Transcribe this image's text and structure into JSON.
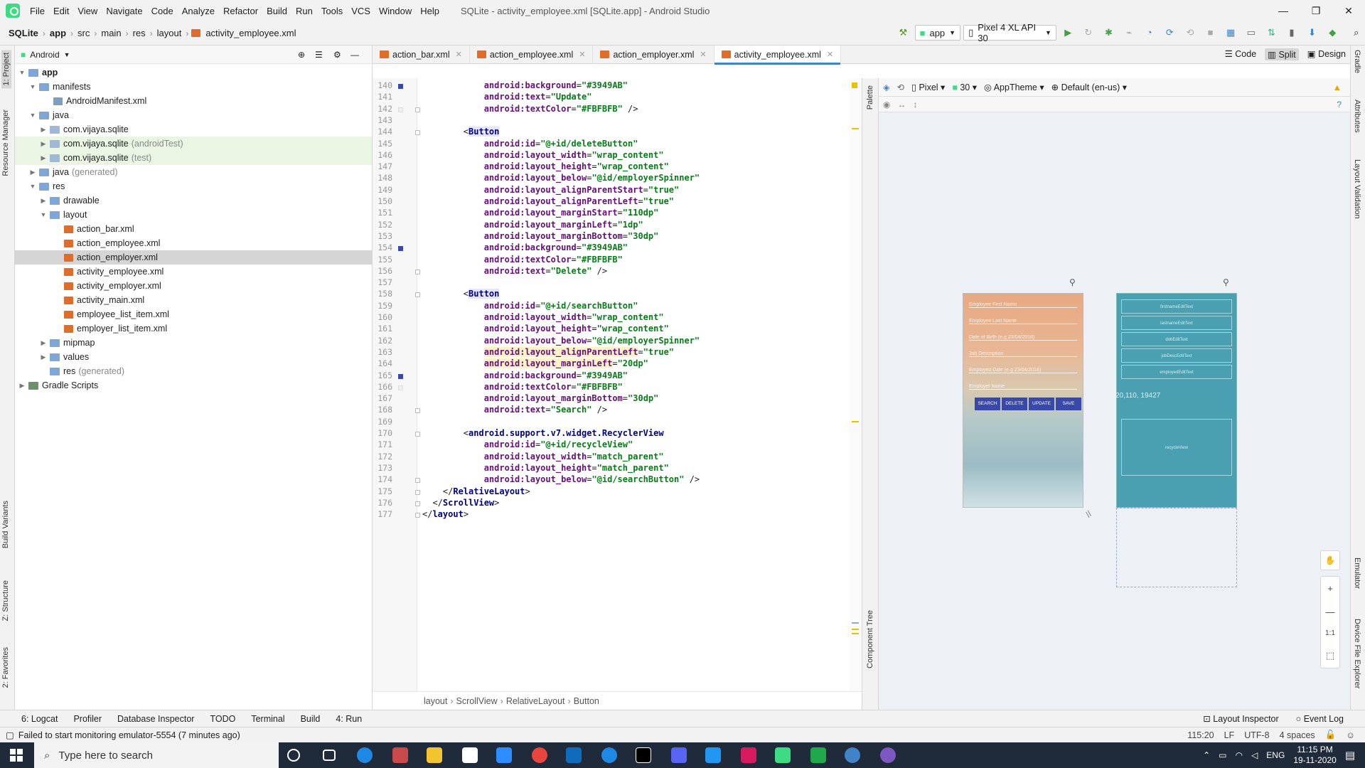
{
  "window": {
    "title": "SQLite - activity_employee.xml [SQLite.app] - Android Studio"
  },
  "menu": [
    "File",
    "Edit",
    "View",
    "Navigate",
    "Code",
    "Analyze",
    "Refactor",
    "Build",
    "Run",
    "Tools",
    "VCS",
    "Window",
    "Help"
  ],
  "breadcrumb": [
    "SQLite",
    "app",
    "src",
    "main",
    "res",
    "layout",
    "activity_employee.xml"
  ],
  "toolbar": {
    "config": "app",
    "device": "Pixel 4 XL API 30"
  },
  "project": {
    "view": "Android",
    "tree": [
      {
        "label": "app",
        "suffix": "",
        "indent": 0,
        "arrow": "▼",
        "icon": "folder",
        "bold": true
      },
      {
        "label": "manifests",
        "suffix": "",
        "indent": 1,
        "arrow": "▼",
        "icon": "folder"
      },
      {
        "label": "AndroidManifest.xml",
        "suffix": "",
        "indent": 2,
        "arrow": "",
        "icon": "manifest"
      },
      {
        "label": "java",
        "suffix": "",
        "indent": 1,
        "arrow": "▼",
        "icon": "folder"
      },
      {
        "label": "com.vijaya.sqlite",
        "suffix": "",
        "indent": 2,
        "arrow": "▶",
        "icon": "pkg"
      },
      {
        "label": "com.vijaya.sqlite",
        "suffix": "(androidTest)",
        "indent": 2,
        "arrow": "▶",
        "icon": "pkg",
        "hl": true
      },
      {
        "label": "com.vijaya.sqlite",
        "suffix": "(test)",
        "indent": 2,
        "arrow": "▶",
        "icon": "pkg",
        "hl": true
      },
      {
        "label": "java",
        "suffix": "(generated)",
        "indent": 1,
        "arrow": "▶",
        "icon": "folder"
      },
      {
        "label": "res",
        "suffix": "",
        "indent": 1,
        "arrow": "▼",
        "icon": "folder"
      },
      {
        "label": "drawable",
        "suffix": "",
        "indent": 2,
        "arrow": "▶",
        "icon": "folder"
      },
      {
        "label": "layout",
        "suffix": "",
        "indent": 2,
        "arrow": "▼",
        "icon": "folder"
      },
      {
        "label": "action_bar.xml",
        "suffix": "",
        "indent": 3,
        "arrow": "",
        "icon": "xml"
      },
      {
        "label": "action_employee.xml",
        "suffix": "",
        "indent": 3,
        "arrow": "",
        "icon": "xml"
      },
      {
        "label": "action_employer.xml",
        "suffix": "",
        "indent": 3,
        "arrow": "",
        "icon": "xml",
        "sel": true
      },
      {
        "label": "activity_employee.xml",
        "suffix": "",
        "indent": 3,
        "arrow": "",
        "icon": "xml"
      },
      {
        "label": "activity_employer.xml",
        "suffix": "",
        "indent": 3,
        "arrow": "",
        "icon": "xml"
      },
      {
        "label": "activity_main.xml",
        "suffix": "",
        "indent": 3,
        "arrow": "",
        "icon": "xml"
      },
      {
        "label": "employee_list_item.xml",
        "suffix": "",
        "indent": 3,
        "arrow": "",
        "icon": "xml"
      },
      {
        "label": "employer_list_item.xml",
        "suffix": "",
        "indent": 3,
        "arrow": "",
        "icon": "xml"
      },
      {
        "label": "mipmap",
        "suffix": "",
        "indent": 2,
        "arrow": "▶",
        "icon": "folder"
      },
      {
        "label": "values",
        "suffix": "",
        "indent": 2,
        "arrow": "▶",
        "icon": "folder"
      },
      {
        "label": "res",
        "suffix": "(generated)",
        "indent": 2,
        "arrow": "",
        "icon": "folder"
      },
      {
        "label": "Gradle Scripts",
        "suffix": "",
        "indent": 0,
        "arrow": "▶",
        "icon": "gradle"
      }
    ]
  },
  "tabs": [
    {
      "label": "action_bar.xml",
      "active": false
    },
    {
      "label": "action_employee.xml",
      "active": false
    },
    {
      "label": "action_employer.xml",
      "active": false
    },
    {
      "label": "activity_employee.xml",
      "active": true
    }
  ],
  "modes": [
    "Code",
    "Split",
    "Design"
  ],
  "editor": {
    "lines": [
      {
        "n": 140,
        "t": "            android:background=\"#3949AB\"",
        "g": "m"
      },
      {
        "n": 141,
        "t": "            android:text=\"Update\""
      },
      {
        "n": 142,
        "t": "            android:textColor=\"#FBFBFB\" />",
        "g": "w",
        "f": true
      },
      {
        "n": 143,
        "t": ""
      },
      {
        "n": 144,
        "t": "        <Button",
        "tagb": true,
        "f": true
      },
      {
        "n": 145,
        "t": "            android:id=\"@+id/deleteButton\""
      },
      {
        "n": 146,
        "t": "            android:layout_width=\"wrap_content\""
      },
      {
        "n": 147,
        "t": "            android:layout_height=\"wrap_content\""
      },
      {
        "n": 148,
        "t": "            android:layout_below=\"@id/employerSpinner\""
      },
      {
        "n": 149,
        "t": "            android:layout_alignParentStart=\"true\""
      },
      {
        "n": 150,
        "t": "            android:layout_alignParentLeft=\"true\""
      },
      {
        "n": 151,
        "t": "            android:layout_marginStart=\"110dp\""
      },
      {
        "n": 152,
        "t": "            android:layout_marginLeft=\"1dp\""
      },
      {
        "n": 153,
        "t": "            android:layout_marginBottom=\"30dp\""
      },
      {
        "n": 154,
        "t": "            android:background=\"#3949AB\"",
        "g": "m"
      },
      {
        "n": 155,
        "t": "            android:textColor=\"#FBFBFB\""
      },
      {
        "n": 156,
        "t": "            android:text=\"Delete\" />",
        "f": true
      },
      {
        "n": 157,
        "t": ""
      },
      {
        "n": 158,
        "t": "        <Button",
        "tagb": true,
        "f": true
      },
      {
        "n": 159,
        "t": "            android:id=\"@+id/searchButton\""
      },
      {
        "n": 160,
        "t": "            android:layout_width=\"wrap_content\""
      },
      {
        "n": 161,
        "t": "            android:layout_height=\"wrap_content\""
      },
      {
        "n": 162,
        "t": "            android:layout_below=\"@id/employerSpinner\""
      },
      {
        "n": 163,
        "t": "            android:layout_alignParentLeft=\"true\"",
        "hl": true
      },
      {
        "n": 164,
        "t": "            android:layout_marginLeft=\"20dp\"",
        "hl": true
      },
      {
        "n": 165,
        "t": "            android:background=\"#3949AB\"",
        "g": "m"
      },
      {
        "n": 166,
        "t": "            android:textColor=\"#FBFBFB\"",
        "g": "w"
      },
      {
        "n": 167,
        "t": "            android:layout_marginBottom=\"30dp\""
      },
      {
        "n": 168,
        "t": "            android:text=\"Search\" />",
        "f": true
      },
      {
        "n": 169,
        "t": ""
      },
      {
        "n": 170,
        "t": "        <android.support.v7.widget.RecyclerView",
        "f": true
      },
      {
        "n": 171,
        "t": "            android:id=\"@+id/recycleView\""
      },
      {
        "n": 172,
        "t": "            android:layout_width=\"match_parent\""
      },
      {
        "n": 173,
        "t": "            android:layout_height=\"match_parent\""
      },
      {
        "n": 174,
        "t": "            android:layout_below=\"@id/searchButton\" />",
        "f": true
      },
      {
        "n": 175,
        "t": "    </RelativeLayout>",
        "f": true
      },
      {
        "n": 176,
        "t": "  </ScrollView>",
        "f": true
      },
      {
        "n": 177,
        "t": "</layout>",
        "f": true
      }
    ]
  },
  "codebar": [
    "layout",
    "ScrollView",
    "RelativeLayout",
    "Button"
  ],
  "design": {
    "device": "Pixel",
    "api": "30",
    "theme": "AppTheme",
    "locale": "Default (en-us)",
    "hints": [
      "Employee First Name",
      "Employee Last Name",
      "Date of Birth (e.g 23/04/2018)",
      "Job Description",
      "Employed Date (e.g 23/04/2018)",
      "Employer Name"
    ],
    "buttons": [
      "SEARCH",
      "DELETE",
      "UPDATE",
      "SAVE"
    ],
    "blueprint": [
      "firstnameEditText",
      "lastnameEditText",
      "dobEditText",
      "jobDescEditText",
      "employedEditText"
    ],
    "blueprint_coords": "20,110, 19427",
    "blueprint_list": "recycleView",
    "zoom": [
      "+",
      "—",
      "1:1"
    ]
  },
  "palette_labels": [
    "Palette",
    "Component Tree"
  ],
  "left_tabs": [
    "1: Project",
    "Resource Manager",
    "Build Variants",
    "Z: Structure",
    "2: Favorites"
  ],
  "right_tabs": [
    "Gradle",
    "Attributes",
    "Layout Validation",
    "Emulator",
    "Device File Explorer"
  ],
  "toolwindows": [
    "6: Logcat",
    "Profiler",
    "Database Inspector",
    "TODO",
    "Terminal",
    "Build",
    "4: Run"
  ],
  "toolwindows_right": [
    "Layout Inspector",
    "Event Log"
  ],
  "status": {
    "message": "Failed to start monitoring emulator-5554 (7 minutes ago)",
    "pos": "115:20",
    "le": "LF",
    "enc": "UTF-8",
    "indent": "4 spaces"
  },
  "taskbar": {
    "search": "Type here to search",
    "lang": "ENG",
    "time": "11:15 PM",
    "date": "19-11-2020"
  },
  "colors": {
    "accent": "#4083c9",
    "button": "#3949AB",
    "xmltag": "#000080",
    "xmlattr": "#660e7a",
    "xmlval": "#067d17"
  }
}
